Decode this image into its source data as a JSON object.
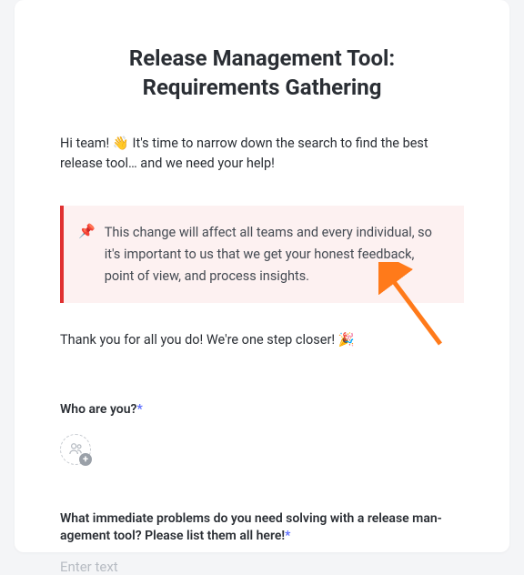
{
  "title": "Release Management Tool: Requirements Gathering",
  "intro_pre": "Hi team! ",
  "intro_emoji": "👋",
  "intro_post": " It's time to narrow down the search to find the best release tool… and we need your help!",
  "callout_icon": "📌",
  "callout_text": "This change will affect all teams and every individual, so it's important to us that we get your honest feedback, point of view, and process insights.",
  "thanks_pre": "Thank you for all you do! We're one step closer! ",
  "thanks_emoji": "🎉",
  "q1_label": "Who are you?",
  "q2_label": "What immediate problems do you need solving with a release man­agement tool? Please list them all here!",
  "required_mark": "*",
  "text_placeholder": "Enter text",
  "plus_symbol": "+"
}
